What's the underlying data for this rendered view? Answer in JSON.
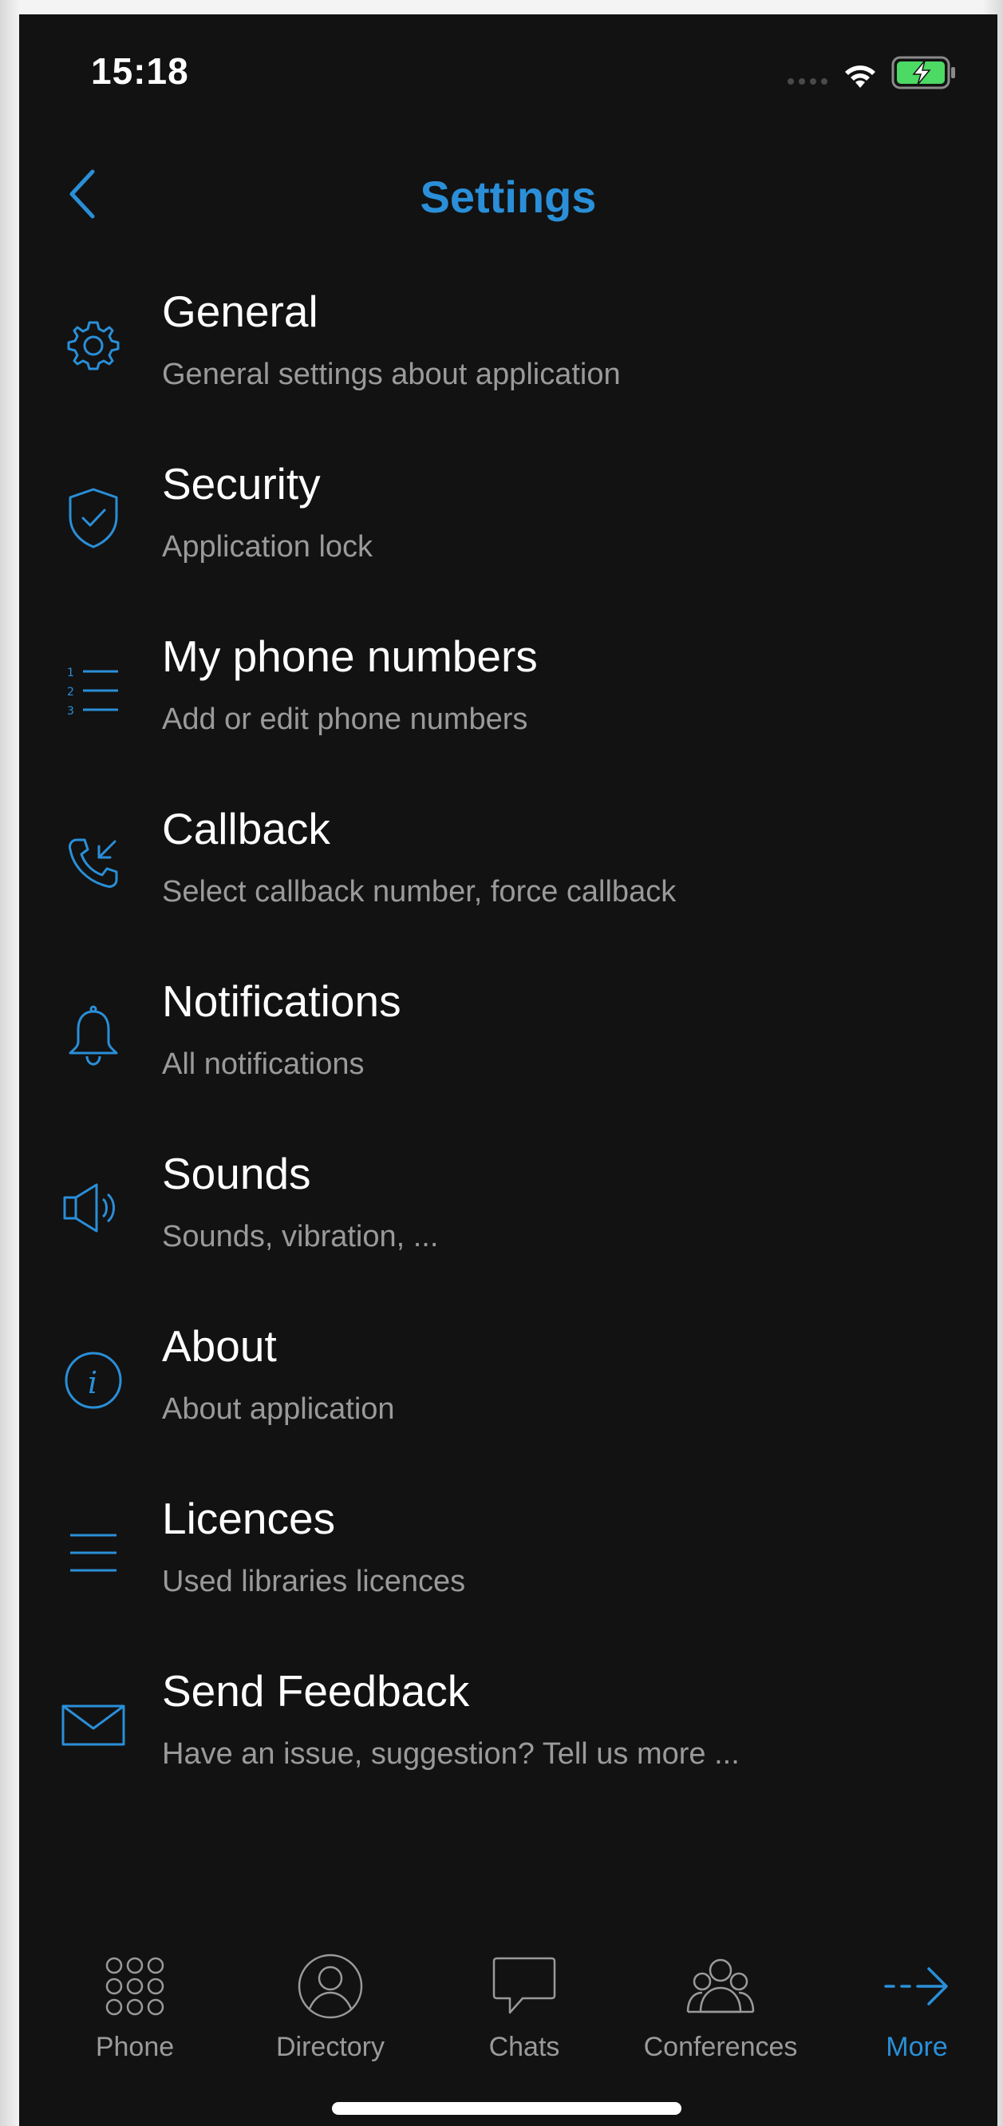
{
  "status_bar": {
    "time": "15:18"
  },
  "header": {
    "title": "Settings",
    "back_icon": "chevron-left-icon"
  },
  "colors": {
    "accent": "#2a8fd8",
    "background": "#121212",
    "title_text": "#ffffff",
    "subtitle_text": "#9a9a9a",
    "battery_fill": "#4cd964"
  },
  "settings": [
    {
      "title": "General",
      "subtitle": "General settings about application",
      "icon": "gear-icon"
    },
    {
      "title": "Security",
      "subtitle": "Application lock",
      "icon": "shield-check-icon"
    },
    {
      "title": "My phone numbers",
      "subtitle": "Add or edit phone numbers",
      "icon": "numbered-list-icon"
    },
    {
      "title": "Callback",
      "subtitle": "Select callback number, force callback",
      "icon": "phone-incoming-icon"
    },
    {
      "title": "Notifications",
      "subtitle": "All notifications",
      "icon": "bell-icon"
    },
    {
      "title": "Sounds",
      "subtitle": "Sounds, vibration, ...",
      "icon": "speaker-icon"
    },
    {
      "title": "About",
      "subtitle": "About application",
      "icon": "info-icon"
    },
    {
      "title": "Licences",
      "subtitle": "Used libraries licences",
      "icon": "lines-icon"
    },
    {
      "title": "Send Feedback",
      "subtitle": "Have an issue, suggestion? Tell us more ...",
      "icon": "envelope-icon"
    }
  ],
  "tab_bar": [
    {
      "label": "Phone",
      "icon": "keypad-icon",
      "active": false
    },
    {
      "label": "Directory",
      "icon": "person-icon",
      "active": false
    },
    {
      "label": "Chats",
      "icon": "chat-bubble-icon",
      "active": false
    },
    {
      "label": "Conferences",
      "icon": "group-icon",
      "active": false
    },
    {
      "label": "More",
      "icon": "arrow-right-icon",
      "active": true
    }
  ]
}
